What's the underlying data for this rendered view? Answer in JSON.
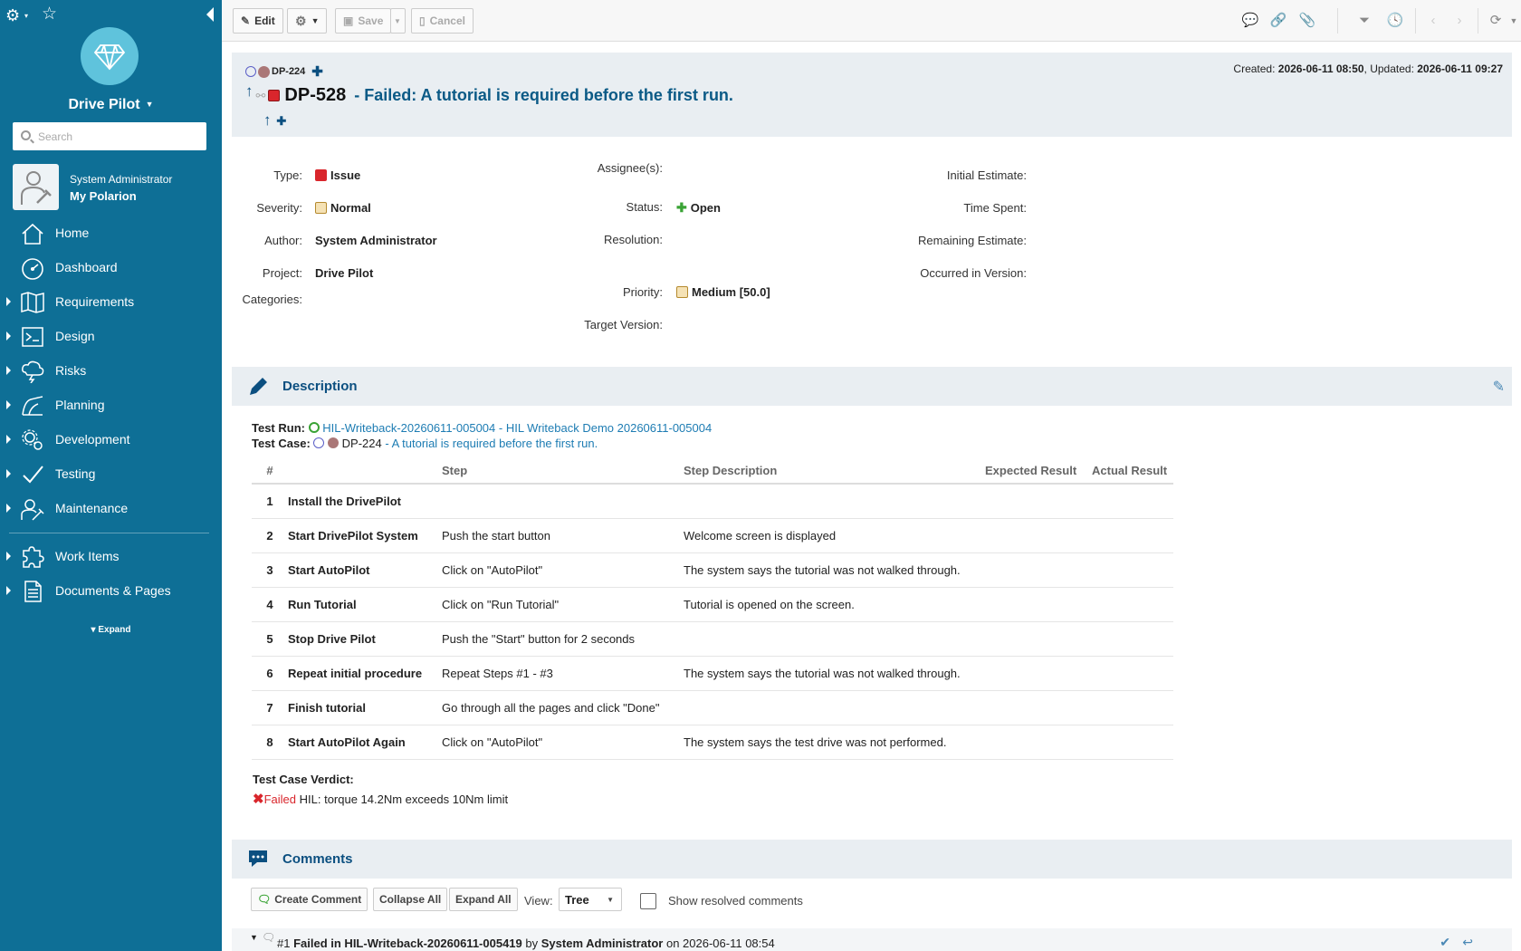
{
  "sidebar": {
    "project_name": "Drive Pilot",
    "search_placeholder": "Search",
    "user_role": "System Administrator",
    "user_link": "My Polarion",
    "nav": [
      {
        "label": "Home",
        "icon": "home-icon",
        "expandable": false
      },
      {
        "label": "Dashboard",
        "icon": "dashboard-icon",
        "expandable": false
      },
      {
        "label": "Requirements",
        "icon": "requirements-icon",
        "expandable": true
      },
      {
        "label": "Design",
        "icon": "design-icon",
        "expandable": true
      },
      {
        "label": "Risks",
        "icon": "risks-icon",
        "expandable": true
      },
      {
        "label": "Planning",
        "icon": "planning-icon",
        "expandable": true
      },
      {
        "label": "Development",
        "icon": "development-icon",
        "expandable": true
      },
      {
        "label": "Testing",
        "icon": "testing-icon",
        "expandable": true
      },
      {
        "label": "Maintenance",
        "icon": "maintenance-icon",
        "expandable": true
      },
      {
        "label": "Work Items",
        "icon": "work-items-icon",
        "expandable": true
      },
      {
        "label": "Documents & Pages",
        "icon": "documents-icon",
        "expandable": true
      }
    ],
    "expand_label": "Expand"
  },
  "toolbar": {
    "edit": "Edit",
    "save": "Save",
    "cancel": "Cancel"
  },
  "header": {
    "parent_id": "DP-224",
    "created_label": "Created:",
    "created": "2026-06-11 08:50",
    "updated_label": ", Updated:",
    "updated": "2026-06-11 09:27",
    "id": "DP-528",
    "title": "- Failed: A tutorial is required before the first run."
  },
  "fields": {
    "type_label": "Type:",
    "type": "Issue",
    "severity_label": "Severity:",
    "severity": "Normal",
    "author_label": "Author:",
    "author": "System Administrator",
    "project_label": "Project:",
    "project": "Drive Pilot",
    "categories_label": "Categories:",
    "assignees_label": "Assignee(s):",
    "status_label": "Status:",
    "status": "Open",
    "resolution_label": "Resolution:",
    "priority_label": "Priority:",
    "priority": "Medium [50.0]",
    "target_version_label": "Target Version:",
    "initial_estimate_label": "Initial Estimate:",
    "time_spent_label": "Time Spent:",
    "remaining_estimate_label": "Remaining Estimate:",
    "occurred_in_version_label": "Occurred in Version:"
  },
  "description": {
    "title": "Description",
    "test_run_label": "Test Run:",
    "test_run_value": "HIL-Writeback-20260611-005004 - HIL Writeback Demo 20260611-005004",
    "test_case_label": "Test Case:",
    "test_case_id": "DP-224",
    "test_case_title": "- A tutorial is required before the first run.",
    "columns": [
      "#",
      "Step",
      "Step Description",
      "Expected Result",
      "Actual Result"
    ],
    "steps": [
      {
        "n": "1",
        "step": "Install the DrivePilot",
        "desc": "",
        "expected": ""
      },
      {
        "n": "2",
        "step": "Start DrivePilot System",
        "desc": "Push the start button",
        "expected": "Welcome screen is displayed"
      },
      {
        "n": "3",
        "step": "Start AutoPilot",
        "desc": "Click on \"AutoPilot\"",
        "expected": "The system says the tutorial was not walked through."
      },
      {
        "n": "4",
        "step": "Run Tutorial",
        "desc": "Click on \"Run Tutorial\"",
        "expected": "Tutorial is opened on the screen."
      },
      {
        "n": "5",
        "step": "Stop Drive Pilot",
        "desc": "Push the \"Start\" button for 2 seconds",
        "expected": ""
      },
      {
        "n": "6",
        "step": "Repeat initial procedure",
        "desc": "Repeat Steps #1 - #3",
        "expected": "The system says the tutorial was not walked through."
      },
      {
        "n": "7",
        "step": "Finish tutorial",
        "desc": "Go through all the pages and click \"Done\"",
        "expected": ""
      },
      {
        "n": "8",
        "step": "Start AutoPilot Again",
        "desc": "Click on \"AutoPilot\"",
        "expected": "The system says the test drive was not performed."
      }
    ],
    "verdict_label": "Test Case Verdict:",
    "verdict_status": "Failed",
    "verdict_text": "HIL: torque 14.2Nm exceeds 10Nm limit"
  },
  "comments": {
    "title": "Comments",
    "create": "Create Comment",
    "collapse_all": "Collapse All",
    "expand_all": "Expand All",
    "view_label": "View:",
    "view_value": "Tree",
    "show_resolved": "Show resolved comments",
    "first": {
      "num": "#1",
      "text": "Failed in HIL-Writeback-20260611-005419",
      "by": "by",
      "author": "System Administrator",
      "on": "on 2026-06-11 08:54"
    }
  },
  "colors": {
    "sidebar": "#0e6f96",
    "accent_link": "#1d7cb3",
    "title_blue": "#0b5a86",
    "section_bg": "#e9eef2",
    "failed_red": "#d9262c",
    "open_green": "#3aa335"
  }
}
